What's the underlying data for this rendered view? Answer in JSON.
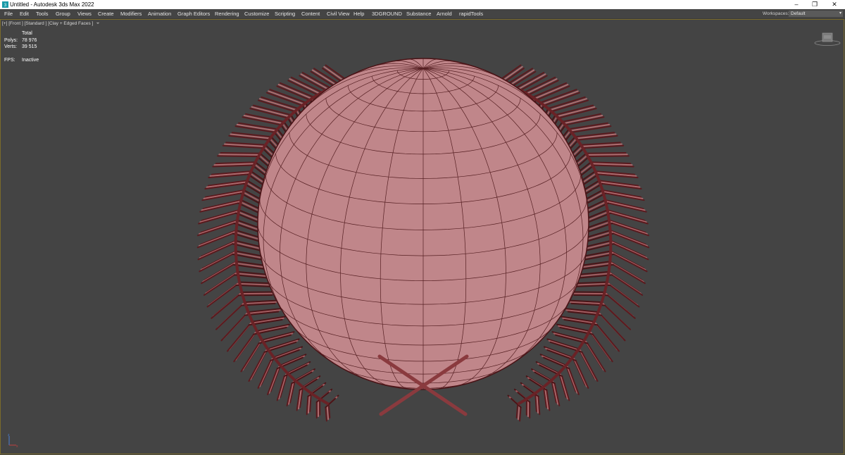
{
  "window": {
    "title": "Untitled - Autodesk 3ds Max 2022",
    "minimize": "–",
    "maximize": "❐",
    "close": "✕"
  },
  "menu": {
    "items": [
      "File",
      "Edit",
      "Tools",
      "Group",
      "Views",
      "Create",
      "Modifiers",
      "Animation",
      "Graph Editors",
      "Rendering",
      "Customize",
      "Scripting",
      "Content",
      "Civil View",
      "Help",
      "3DGROUND",
      "Substance",
      "Arnold",
      "rapidTools"
    ],
    "workspaces_label": "Workspaces:",
    "workspaces_value": "Default"
  },
  "viewport": {
    "label": "[+] [Front ] [Standard ] [Clay + Edged Faces ]",
    "stats": {
      "header": "Total",
      "polys_label": "Polys:",
      "polys_value": "78 976",
      "verts_label": "Verts:",
      "verts_value": "39 515",
      "fps_label": "FPS:",
      "fps_value": "Inactive"
    }
  },
  "colors": {
    "viewport_bg": "#444444",
    "clay_fill": "#c0868a",
    "clay_dark": "#7a3034",
    "wire": "#4a1417",
    "viewport_border": "#7a6b2a"
  }
}
